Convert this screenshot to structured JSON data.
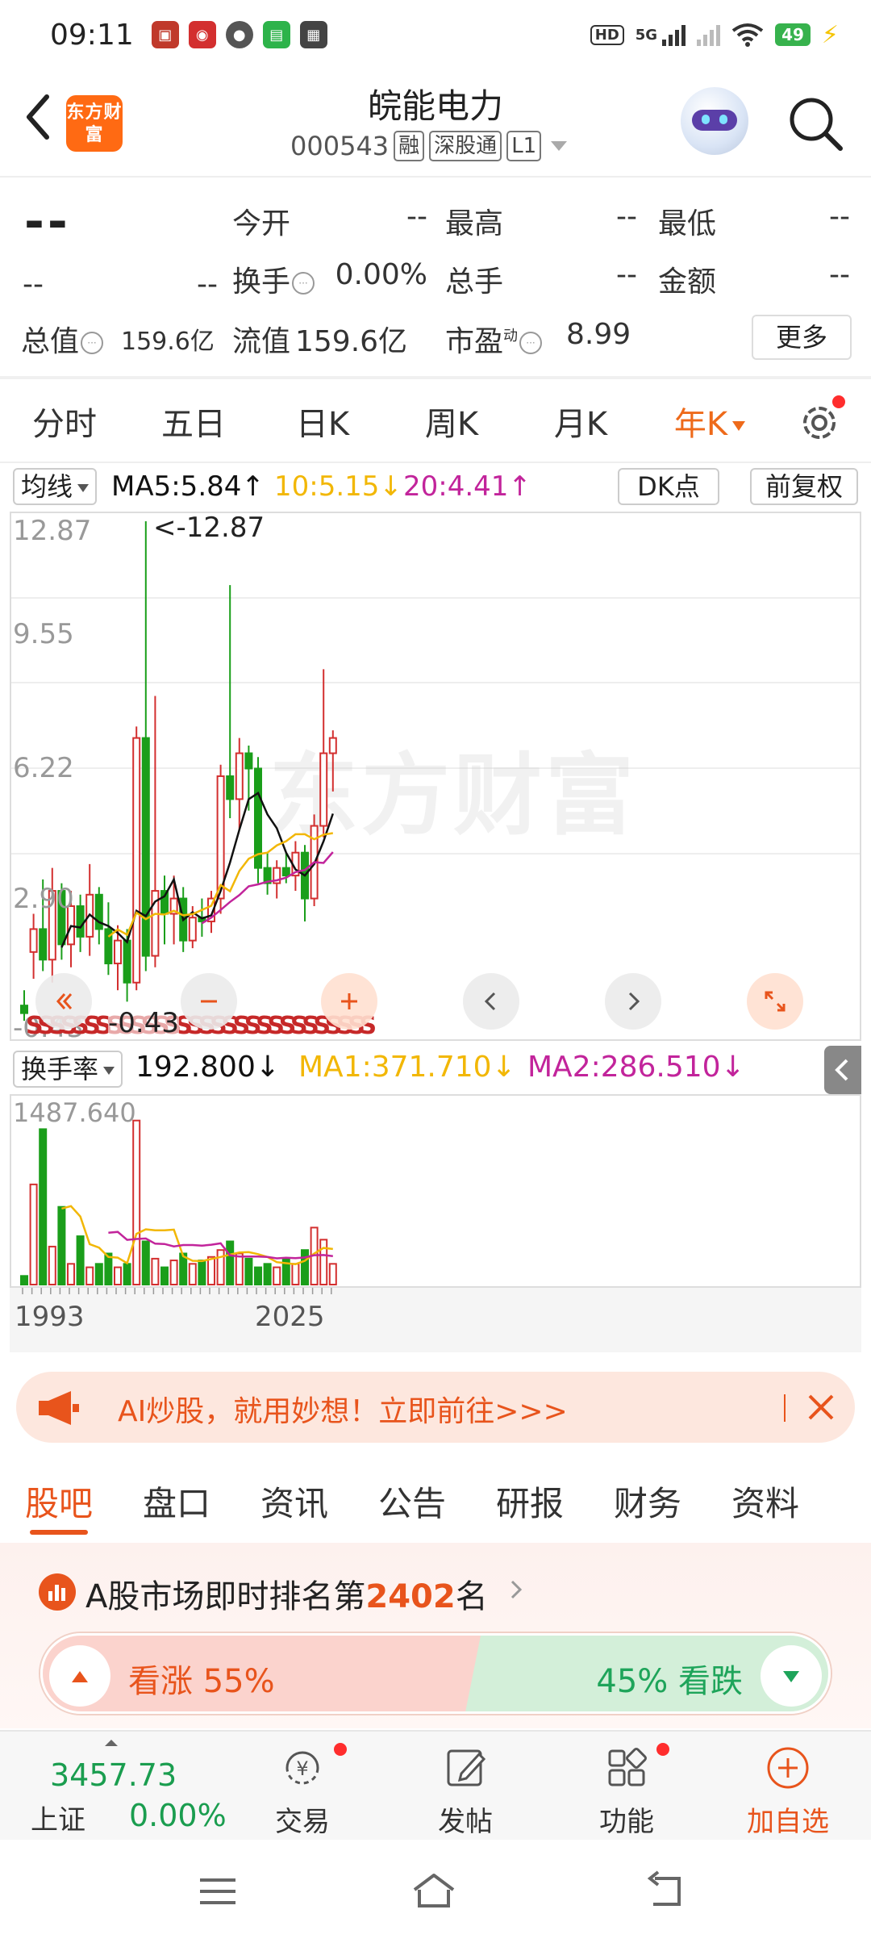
{
  "status_bar": {
    "time": "09:11",
    "network": "5G",
    "battery": "49",
    "hd_label": "HD"
  },
  "header": {
    "brand_logo_text": "东方财富",
    "stock_name": "皖能电力",
    "stock_code": "000543",
    "margin_badge": "融",
    "connect_badge": "深股通",
    "level_badge": "L1"
  },
  "quote": {
    "price": "--",
    "change": "--",
    "change_pct": "--",
    "fields": [
      {
        "label": "今开",
        "value": "--"
      },
      {
        "label": "最高",
        "value": "--"
      },
      {
        "label": "最低",
        "value": "--"
      },
      {
        "label": "换手",
        "value": "0.00%"
      },
      {
        "label": "总手",
        "value": "--"
      },
      {
        "label": "金额",
        "value": "--"
      }
    ],
    "total_cap_label": "总值",
    "total_cap_value": "159.6亿",
    "float_cap_label": "流值",
    "float_cap_value": "159.6亿",
    "pe_label": "市盈",
    "pe_super": "动",
    "pe_value": "8.99",
    "more_label": "更多"
  },
  "period_tabs": [
    {
      "label": "分时",
      "active": false
    },
    {
      "label": "五日",
      "active": false
    },
    {
      "label": "日K",
      "active": false
    },
    {
      "label": "周K",
      "active": false
    },
    {
      "label": "月K",
      "active": false
    },
    {
      "label": "年K",
      "active": true
    }
  ],
  "indicator": {
    "select_label": "均线",
    "ma5": "MA5:5.84↑",
    "ma10": "10:5.15↓",
    "ma20": "20:4.41↑",
    "dk_label": "DK点",
    "adjust_label": "前复权"
  },
  "colors": {
    "up": "#d32f2f",
    "down": "#1a9e1a",
    "ma5": "#111111",
    "ma10": "#f2b705",
    "ma20": "#c2249b",
    "accent": "#e8541c"
  },
  "k_chart": {
    "y_labels": [
      "12.87",
      "9.55",
      "6.22",
      "2.90",
      "-0.43"
    ],
    "max_label": "<-12.87",
    "low_label": "-0.43",
    "watermark": "东方财富",
    "s_markers": "SSSSSSSSSSSSSSSSSSSSSSSSSSSSSS"
  },
  "volume": {
    "select_label": "换手率",
    "value": "192.800↓",
    "ma1": "MA1:371.710↓",
    "ma2": "MA2:286.510↓",
    "max_label": "1487.640"
  },
  "x_axis": {
    "start": "1993",
    "end": "2025"
  },
  "chart_data": {
    "type": "candlestick",
    "x_range": [
      1993,
      2025
    ],
    "y_range": [
      -0.43,
      12.87
    ],
    "volume_max": 1487.64,
    "moving_averages": [
      {
        "name": "MA5",
        "last": 5.84
      },
      {
        "name": "MA10",
        "last": 5.15
      },
      {
        "name": "MA20",
        "last": 4.41
      }
    ],
    "turnover_mas": [
      {
        "name": "MA1",
        "last": 371.71
      },
      {
        "name": "MA2",
        "last": 286.51
      }
    ],
    "candles": [
      {
        "o": 0.2,
        "h": 0.6,
        "l": -0.2,
        "c": 0.0
      },
      {
        "o": 1.6,
        "h": 2.6,
        "l": 0.9,
        "c": 2.2
      },
      {
        "o": 2.2,
        "h": 3.5,
        "l": 1.1,
        "c": 1.4
      },
      {
        "o": 1.4,
        "h": 3.8,
        "l": 0.8,
        "c": 3.2
      },
      {
        "o": 3.2,
        "h": 3.4,
        "l": 1.4,
        "c": 1.8
      },
      {
        "o": 1.8,
        "h": 3.2,
        "l": 1.2,
        "c": 2.8
      },
      {
        "o": 2.8,
        "h": 3.1,
        "l": 1.6,
        "c": 2.0
      },
      {
        "o": 2.0,
        "h": 3.9,
        "l": 1.5,
        "c": 3.1
      },
      {
        "o": 3.1,
        "h": 3.3,
        "l": 1.8,
        "c": 2.2
      },
      {
        "o": 2.2,
        "h": 2.9,
        "l": 1.0,
        "c": 1.3
      },
      {
        "o": 1.3,
        "h": 2.3,
        "l": 0.6,
        "c": 1.9
      },
      {
        "o": 1.9,
        "h": 2.2,
        "l": 0.3,
        "c": 0.8
      },
      {
        "o": 0.8,
        "h": 7.5,
        "l": 0.6,
        "c": 7.2
      },
      {
        "o": 7.2,
        "h": 12.87,
        "l": 1.1,
        "c": 1.5
      },
      {
        "o": 1.5,
        "h": 8.3,
        "l": 1.2,
        "c": 3.2
      },
      {
        "o": 3.2,
        "h": 3.6,
        "l": 1.8,
        "c": 2.6
      },
      {
        "o": 2.6,
        "h": 3.6,
        "l": 1.8,
        "c": 3.0
      },
      {
        "o": 3.0,
        "h": 3.3,
        "l": 1.6,
        "c": 1.9
      },
      {
        "o": 1.9,
        "h": 2.8,
        "l": 1.7,
        "c": 2.5
      },
      {
        "o": 2.5,
        "h": 3.0,
        "l": 2.0,
        "c": 2.4
      },
      {
        "o": 2.4,
        "h": 3.2,
        "l": 2.1,
        "c": 3.0
      },
      {
        "o": 3.0,
        "h": 6.5,
        "l": 2.6,
        "c": 6.2
      },
      {
        "o": 6.2,
        "h": 11.2,
        "l": 5.1,
        "c": 5.6
      },
      {
        "o": 5.6,
        "h": 7.2,
        "l": 4.8,
        "c": 6.8
      },
      {
        "o": 6.8,
        "h": 7.0,
        "l": 5.3,
        "c": 6.4
      },
      {
        "o": 6.4,
        "h": 6.7,
        "l": 3.4,
        "c": 3.8
      },
      {
        "o": 3.8,
        "h": 4.2,
        "l": 3.1,
        "c": 3.4
      },
      {
        "o": 3.4,
        "h": 4.0,
        "l": 3.0,
        "c": 3.8
      },
      {
        "o": 3.8,
        "h": 4.2,
        "l": 3.4,
        "c": 3.6
      },
      {
        "o": 3.6,
        "h": 4.5,
        "l": 3.2,
        "c": 4.2
      },
      {
        "o": 4.2,
        "h": 4.4,
        "l": 2.4,
        "c": 3.0
      },
      {
        "o": 3.0,
        "h": 5.2,
        "l": 2.8,
        "c": 4.9
      },
      {
        "o": 4.9,
        "h": 9.0,
        "l": 4.6,
        "c": 6.8
      },
      {
        "o": 6.8,
        "h": 7.4,
        "l": 5.8,
        "c": 7.2
      }
    ]
  },
  "promo": {
    "text": "AI炒股，就用妙想！立即前往>>>"
  },
  "section_tabs": [
    {
      "label": "股吧",
      "active": true
    },
    {
      "label": "盘口",
      "active": false
    },
    {
      "label": "资讯",
      "active": false
    },
    {
      "label": "公告",
      "active": false
    },
    {
      "label": "研报",
      "active": false
    },
    {
      "label": "财务",
      "active": false
    },
    {
      "label": "资料",
      "active": false
    }
  ],
  "ranking": {
    "prefix": "A股市场即时排名第",
    "rank": "2402",
    "suffix": "名"
  },
  "sentiment": {
    "bull_label": "看涨 55%",
    "bear_label": "45% 看跌",
    "bull_pct": 55,
    "bear_pct": 45
  },
  "bottom_bar": {
    "index_value": "3457.73",
    "index_name": "上证",
    "index_change": "0.00%",
    "items": [
      {
        "label": "交易",
        "icon": "yuan-icon"
      },
      {
        "label": "发帖",
        "icon": "edit-icon"
      },
      {
        "label": "功能",
        "icon": "grid-icon"
      },
      {
        "label": "加自选",
        "icon": "add-circle-icon"
      }
    ]
  }
}
